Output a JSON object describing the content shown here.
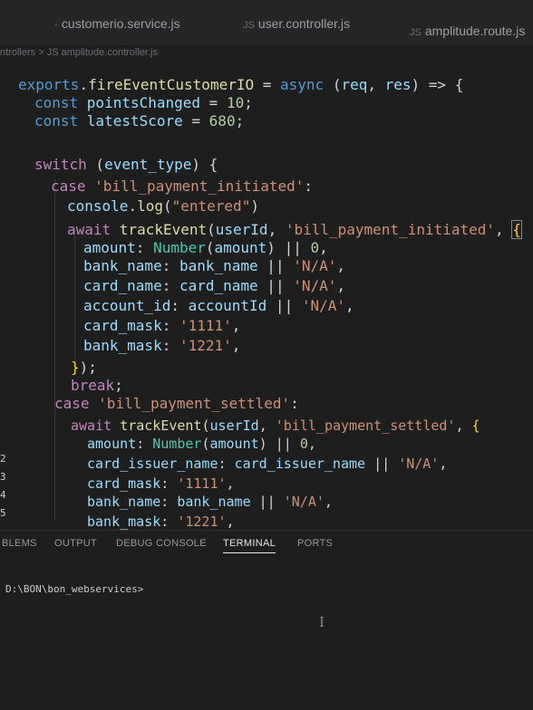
{
  "tabs": [
    {
      "label": "customerio.service.js",
      "icon": "js-file-icon"
    },
    {
      "label": "user.controller.js",
      "icon": "js-file-icon"
    },
    {
      "label": "amplitude.route.js",
      "icon": "js-file-icon"
    }
  ],
  "breadcrumb": {
    "folder": "ntrollers",
    "separator": ">",
    "file_type": "JS",
    "file": "amplitude.controller.js"
  },
  "line_numbers": [
    "2",
    "3",
    "4",
    "5"
  ],
  "code": [
    [
      [
        "t-kw",
        "exports"
      ],
      [
        "t-op",
        "."
      ],
      [
        "t-fn",
        "fireEventCustomerIO"
      ],
      [
        "t-op",
        " = "
      ],
      [
        "t-kw",
        "async"
      ],
      [
        "t-op",
        " ("
      ],
      [
        "t-var",
        "req"
      ],
      [
        "t-op",
        ", "
      ],
      [
        "t-var",
        "res"
      ],
      [
        "t-op",
        ") => {"
      ]
    ],
    [
      [
        "t-kw",
        "const "
      ],
      [
        "t-var",
        "pointsChanged"
      ],
      [
        "t-op",
        " = "
      ],
      [
        "t-num",
        "10"
      ],
      [
        "t-op",
        ";"
      ]
    ],
    [
      [
        "t-kw",
        "const "
      ],
      [
        "t-var",
        "latestScore"
      ],
      [
        "t-op",
        " = "
      ],
      [
        "t-num",
        "680"
      ],
      [
        "t-op",
        ";"
      ]
    ],
    [],
    [
      [
        "t-ctrl",
        "switch"
      ],
      [
        "t-op",
        " ("
      ],
      [
        "t-var",
        "event_type"
      ],
      [
        "t-op",
        ") {"
      ]
    ],
    [
      [
        "t-ctrl",
        "case "
      ],
      [
        "t-str",
        "'bill_payment_initiated'"
      ],
      [
        "t-op",
        ":"
      ]
    ],
    [
      [
        "t-var",
        "console"
      ],
      [
        "t-op",
        "."
      ],
      [
        "t-fn",
        "log"
      ],
      [
        "t-op",
        "("
      ],
      [
        "t-str",
        "\"entered\""
      ],
      [
        "t-op",
        ")"
      ]
    ],
    [
      [
        "t-ctrl",
        "await "
      ],
      [
        "t-fn",
        "trackEvent"
      ],
      [
        "t-op",
        "("
      ],
      [
        "t-var",
        "userId"
      ],
      [
        "t-op",
        ", "
      ],
      [
        "t-str",
        "'bill_payment_initiated'"
      ],
      [
        "t-op",
        ", "
      ],
      [
        "t-br1",
        "{"
      ]
    ],
    [
      [
        "t-prop",
        "amount"
      ],
      [
        "t-op",
        ": "
      ],
      [
        "t-type",
        "Number"
      ],
      [
        "t-op",
        "("
      ],
      [
        "t-var",
        "amount"
      ],
      [
        "t-op",
        ") || "
      ],
      [
        "t-num",
        "0"
      ],
      [
        "t-op",
        ","
      ]
    ],
    [
      [
        "t-prop",
        "bank_name"
      ],
      [
        "t-op",
        ": "
      ],
      [
        "t-var",
        "bank_name"
      ],
      [
        "t-op",
        " || "
      ],
      [
        "t-str",
        "'N/A'"
      ],
      [
        "t-op",
        ","
      ]
    ],
    [
      [
        "t-prop",
        "card_name"
      ],
      [
        "t-op",
        ": "
      ],
      [
        "t-var",
        "card_name"
      ],
      [
        "t-op",
        " || "
      ],
      [
        "t-str",
        "'N/A'"
      ],
      [
        "t-op",
        ","
      ]
    ],
    [
      [
        "t-prop",
        "account_id"
      ],
      [
        "t-op",
        ": "
      ],
      [
        "t-var",
        "accountId"
      ],
      [
        "t-op",
        " || "
      ],
      [
        "t-str",
        "'N/A'"
      ],
      [
        "t-op",
        ","
      ]
    ],
    [
      [
        "t-prop",
        "card_mask"
      ],
      [
        "t-op",
        ": "
      ],
      [
        "t-str",
        "'1111'"
      ],
      [
        "t-op",
        ","
      ]
    ],
    [
      [
        "t-prop",
        "bank_mask"
      ],
      [
        "t-op",
        ": "
      ],
      [
        "t-str",
        "'1221'"
      ],
      [
        "t-op",
        ","
      ]
    ],
    [
      [
        "t-br1",
        "}"
      ],
      [
        "t-op",
        ");"
      ]
    ],
    [
      [
        "t-ctrl",
        "break"
      ],
      [
        "t-op",
        ";"
      ]
    ],
    [
      [
        "t-ctrl",
        "case "
      ],
      [
        "t-str",
        "'bill_payment_settled'"
      ],
      [
        "t-op",
        ":"
      ]
    ],
    [
      [
        "t-ctrl",
        "await "
      ],
      [
        "t-fn",
        "trackEvent"
      ],
      [
        "t-op",
        "("
      ],
      [
        "t-var",
        "userId"
      ],
      [
        "t-op",
        ", "
      ],
      [
        "t-str",
        "'bill_payment_settled'"
      ],
      [
        "t-op",
        ", "
      ],
      [
        "t-br1",
        "{"
      ]
    ],
    [
      [
        "t-prop",
        "amount"
      ],
      [
        "t-op",
        ": "
      ],
      [
        "t-type",
        "Number"
      ],
      [
        "t-op",
        "("
      ],
      [
        "t-var",
        "amount"
      ],
      [
        "t-op",
        ") || "
      ],
      [
        "t-num",
        "0"
      ],
      [
        "t-op",
        ","
      ]
    ],
    [
      [
        "t-prop",
        "card_issuer_name"
      ],
      [
        "t-op",
        ": "
      ],
      [
        "t-var",
        "card_issuer_name"
      ],
      [
        "t-op",
        " || "
      ],
      [
        "t-str",
        "'N/A'"
      ],
      [
        "t-op",
        ","
      ]
    ],
    [
      [
        "t-prop",
        "card_mask"
      ],
      [
        "t-op",
        ": "
      ],
      [
        "t-str",
        "'1111'"
      ],
      [
        "t-op",
        ","
      ]
    ],
    [
      [
        "t-prop",
        "bank_name"
      ],
      [
        "t-op",
        ": "
      ],
      [
        "t-var",
        "bank_name"
      ],
      [
        "t-op",
        " || "
      ],
      [
        "t-str",
        "'N/A'"
      ],
      [
        "t-op",
        ","
      ]
    ],
    [
      [
        "t-prop",
        "bank_mask"
      ],
      [
        "t-op",
        ": "
      ],
      [
        "t-str",
        "'1221'"
      ],
      [
        "t-op",
        ","
      ]
    ]
  ],
  "panel_tabs": [
    "BLEMS",
    "OUTPUT",
    "DEBUG CONSOLE",
    "TERMINAL",
    "PORTS"
  ],
  "active_panel_tab": "TERMINAL",
  "terminal": {
    "prompt": "D:\\BON\\bon_webservices>",
    "cursor_glyph": "I"
  },
  "colors": {
    "background": "#1e1e1e",
    "keyword": "#569cd6",
    "control": "#c586c0",
    "function": "#dcdcaa",
    "variable": "#9cdcfe",
    "string": "#ce9178",
    "number": "#b5cea8",
    "type": "#4ec9b0",
    "bracket": "#ffd700"
  }
}
